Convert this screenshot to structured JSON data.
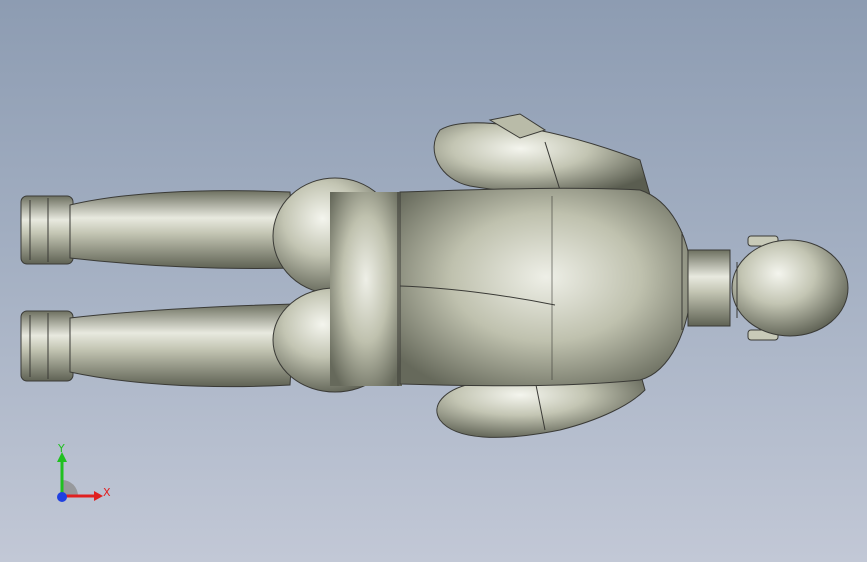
{
  "viewport": {
    "background_top": "#8d9cb2",
    "background_bottom": "#c2c8d6"
  },
  "model": {
    "name": "humanoid-figure",
    "surface_color": "#c4c6b4",
    "edge_color": "#3a3a36"
  },
  "triad": {
    "x_label": "X",
    "y_label": "Y",
    "x_color": "#e02020",
    "y_color": "#20c020",
    "z_color": "#2040e0"
  }
}
